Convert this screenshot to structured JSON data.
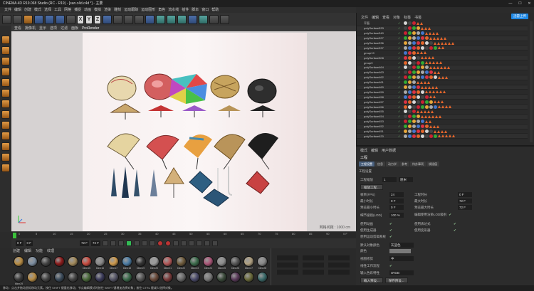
{
  "window": {
    "title": "CINEMA 4D R19.068 Studio (RC - R19) - [san.c4d.c4d *] - 主要",
    "login_label": "迅雷上传"
  },
  "menu": [
    "文件",
    "编辑",
    "创建",
    "模式",
    "选择",
    "工具",
    "网格",
    "捕捉",
    "动画",
    "模拟",
    "渲染",
    "雕刻",
    "运动跟踪",
    "运动图形",
    "角色",
    "流水线",
    "插件",
    "脚本",
    "窗口",
    "帮助"
  ],
  "toolbar": {
    "x": "X",
    "y": "Y",
    "z": "Z"
  },
  "viewport": {
    "menu": [
      "查看",
      "摄像机",
      "显示",
      "选项",
      "过滤",
      "面板"
    ],
    "renderer": "ProRender",
    "status": "网格间距 : 1000 cm"
  },
  "timeline": {
    "ticks": [
      "0",
      "5",
      "10",
      "15",
      "20",
      "25",
      "30",
      "35",
      "40",
      "45",
      "50",
      "55",
      "60",
      "65",
      "70",
      "75",
      "80",
      "85",
      "90"
    ],
    "end": "0 F"
  },
  "transport": {
    "cur": "0 F",
    "start": "0 F",
    "end": "72 F",
    "end2": "72 F"
  },
  "materials": {
    "tabs": [
      "创建",
      "编辑",
      "功能",
      "纹理"
    ],
    "items": [
      {
        "label": "",
        "color": "#b88c43"
      },
      {
        "label": "",
        "color": "#7d8ea1"
      },
      {
        "label": "",
        "color": "#444"
      },
      {
        "label": "",
        "color": "#8b1a1a"
      },
      {
        "label": "",
        "color": "#a38a5b"
      },
      {
        "label": "blinn15",
        "color": "#c94b3f"
      },
      {
        "label": "blinn16",
        "color": "#888"
      },
      {
        "label": "blinn17",
        "color": "#cf9b4d"
      },
      {
        "label": "blinn18",
        "color": "#4a7ba3"
      },
      {
        "label": "blinn19",
        "color": "#333"
      },
      {
        "label": "blinn20",
        "color": "#9b9b9b"
      },
      {
        "label": "blinn21",
        "color": "#b35656"
      },
      {
        "label": "blinn22",
        "color": "#6f5b3b"
      },
      {
        "label": "blinn23",
        "color": "#3a6a4a"
      },
      {
        "label": "blinn24",
        "color": "#aa5577"
      },
      {
        "label": "blinn25",
        "color": "#8c8c8c"
      },
      {
        "label": "blinn26",
        "color": "#555"
      },
      {
        "label": "blinn27",
        "color": "#b0a080"
      },
      {
        "label": "blinn28",
        "color": "#888"
      },
      {
        "label": "blinn29",
        "color": "#3a3a3a"
      },
      {
        "label": "",
        "color": "#b88c43"
      },
      {
        "label": "",
        "color": "#444"
      },
      {
        "label": "",
        "color": "#3a4a5a"
      },
      {
        "label": "",
        "color": "#444"
      },
      {
        "label": "",
        "color": "#4a6a3a"
      },
      {
        "label": "",
        "color": "#3a3a5a"
      },
      {
        "label": "",
        "color": "#556"
      },
      {
        "label": "",
        "color": "#3a6a4a"
      },
      {
        "label": "",
        "color": "#555"
      },
      {
        "label": "",
        "color": "#6a4a3a"
      },
      {
        "label": "",
        "color": "#7a3a3a"
      },
      {
        "label": "",
        "color": "#6a6a6a"
      },
      {
        "label": "",
        "color": "#4a4a6a"
      },
      {
        "label": "",
        "color": "#777"
      },
      {
        "label": "",
        "color": "#3a4a3a"
      },
      {
        "label": "",
        "color": "#5a3a5a"
      },
      {
        "label": "",
        "color": "#6a6a3a"
      },
      {
        "label": "",
        "color": "#3a6a6a"
      }
    ]
  },
  "objects": {
    "tabs": [
      "文件",
      "编辑",
      "查看",
      "对象",
      "标签",
      "书签"
    ],
    "rows": [
      "平面",
      "polySurface533",
      "polySurface540",
      "polySurface527",
      "polySurface536",
      "polySurface537",
      "group19",
      "polySurface508",
      "group9",
      "polySurface464",
      "polySurface463",
      "polySurface462",
      "polySurface461",
      "polySurface460",
      "polySurface459",
      "polySurface458",
      "polySurface457",
      "polySurface456",
      "polySurface455",
      "polySurface454",
      "polySurface453",
      "polySurface452",
      "polySurface451",
      "polySurface420"
    ]
  },
  "attributes": {
    "menu": [
      "模式",
      "编辑",
      "用户数据"
    ],
    "title": "工程",
    "tabs": [
      "工程设置",
      "信息",
      "动力学",
      "参考",
      "待办事项",
      "帧插值"
    ],
    "section": "工程设置",
    "scale_label": "工程缩放",
    "scale_value": "1",
    "scale_unit": "厘米",
    "scale_btn": "缩放工程...",
    "fps_label": "帧率(FPS)",
    "fps_value": "24",
    "projtime_label": "工程时长",
    "projtime_value": "0 F",
    "min_label": "最小时长",
    "min_value": "0 F",
    "max_label": "最大时长",
    "max_value": "72 F",
    "pmin_label": "预览最小时长",
    "pmin_value": "0 F",
    "pmax_label": "预览最大时长",
    "pmax_value": "72 F",
    "lod_label": "细节级别(LOD)",
    "lod_value": "100 %",
    "lod_note": "编辑使用渲染LOD级别",
    "anim_label": "使用动画",
    "expr_label": "使用表达式",
    "gen_label": "使用生成器",
    "deform_label": "使用变形器",
    "motion_label": "使用运动剪辑系统",
    "objcolor_label": "默认对象颜色",
    "objcolor_value": "灰蓝色",
    "color_label": "颜色",
    "view_label": "视图修剪",
    "view_value": "中",
    "linear_label": "线性工作流程",
    "cprofile_label": "输入色彩特性",
    "cprofile_value": "sRGB",
    "load_btn": "载入预设...",
    "save_btn": "保存预设..."
  },
  "status": "移动：点击并拖动鼠标移动元素。按住 SHIFT 键量化移动；节点编辑模式时按住 SHIFT 键增加选择对象；按住 CTRL 键减少选择对象。"
}
